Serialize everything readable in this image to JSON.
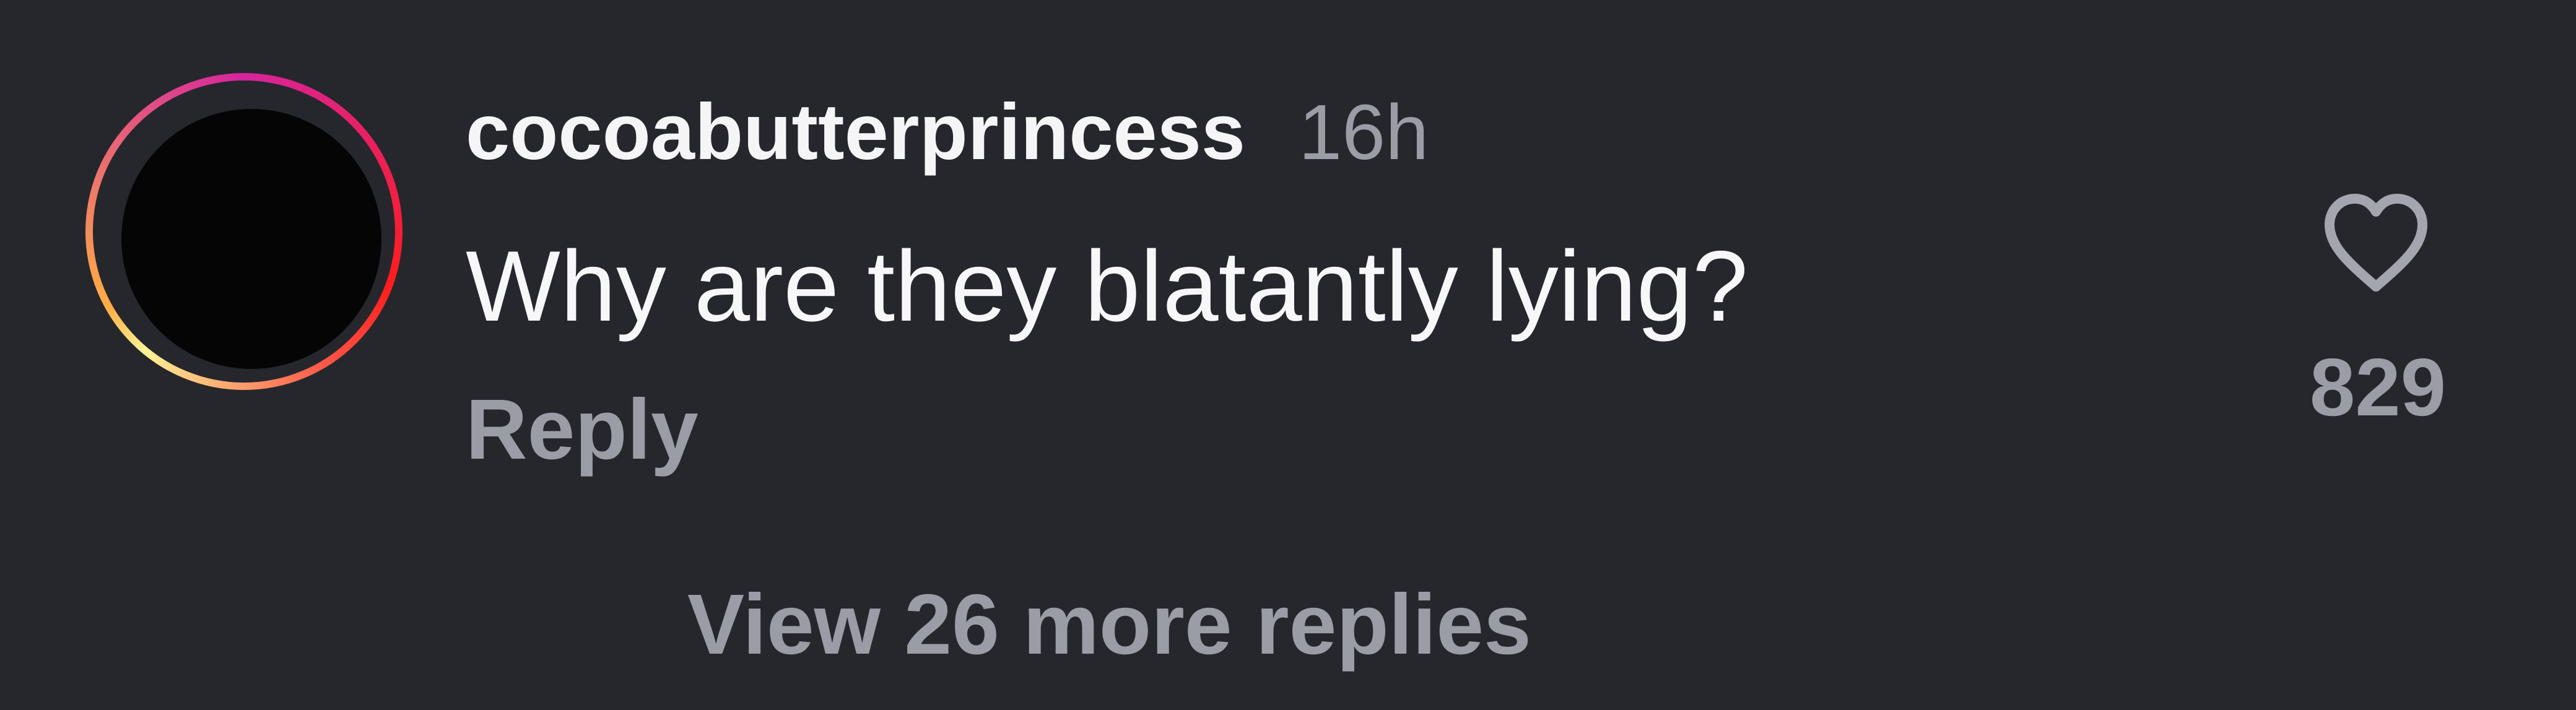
{
  "comment": {
    "username": "cocoabutterprincess",
    "time": "16h",
    "text": "Why are they blatantly lying?",
    "reply_label": "Reply",
    "like_count": "829",
    "view_replies_label": "View 26 more replies"
  },
  "icons": {
    "like": "heart-outline-icon",
    "avatar": "story-ring-avatar"
  },
  "colors": {
    "background": "#26272c",
    "primary_text": "#f5f5f7",
    "secondary_text": "#9a9ca6",
    "story_ring_start": "#d6249f",
    "story_ring_end": "#fcaf45"
  }
}
